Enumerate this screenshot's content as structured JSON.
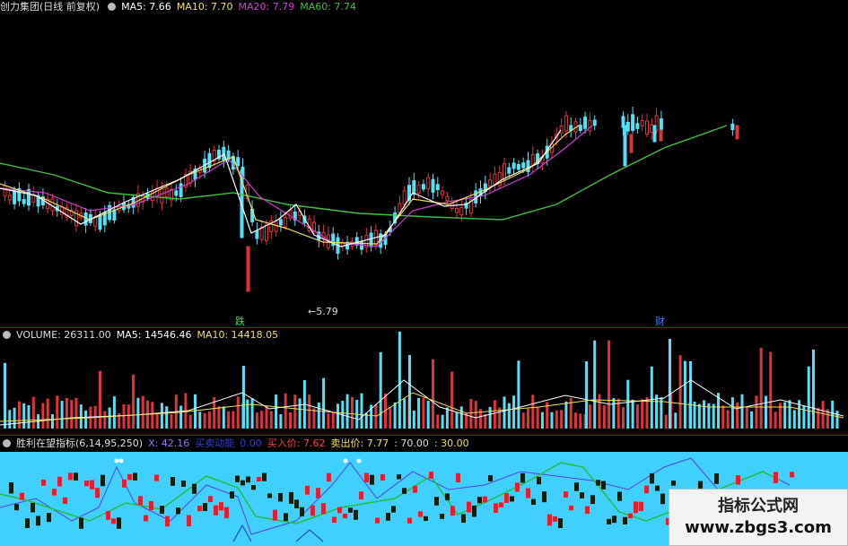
{
  "main_header": {
    "title": "创力集团(日线 前复权)",
    "ma5": "MA5: 7.66",
    "ma10": "MA10: 7.70",
    "ma20": "MA20: 7.79",
    "ma60": "MA60: 7.74"
  },
  "main_signals": {
    "die": "跌",
    "low_price": "←5.79",
    "cai": "财"
  },
  "volume_header": {
    "volume": "VOLUME: 26311.00",
    "ma5": "MA5: 14546.46",
    "ma10": "MA10: 14418.05"
  },
  "indicator_header": {
    "name": "胜利在望指标(6,14,95,250)",
    "x": "X: 42.16",
    "smart": "买卖动能",
    "val": "0.00",
    "buy": "买入价: 7.62",
    "sell": "卖出价: 7.77",
    "p70": ": 70.00",
    "p30": ": 30.00"
  },
  "watermark": {
    "title": "指标公式网",
    "url": "www.zbgs3.com"
  },
  "colors": {
    "up": "#e0333a",
    "down": "#55e0f5",
    "ma5": "#ffffff",
    "ma10": "#f0e060",
    "ma20": "#d040d0",
    "ma60": "#40c040",
    "indicator_bg": "#3fd0ff"
  }
}
